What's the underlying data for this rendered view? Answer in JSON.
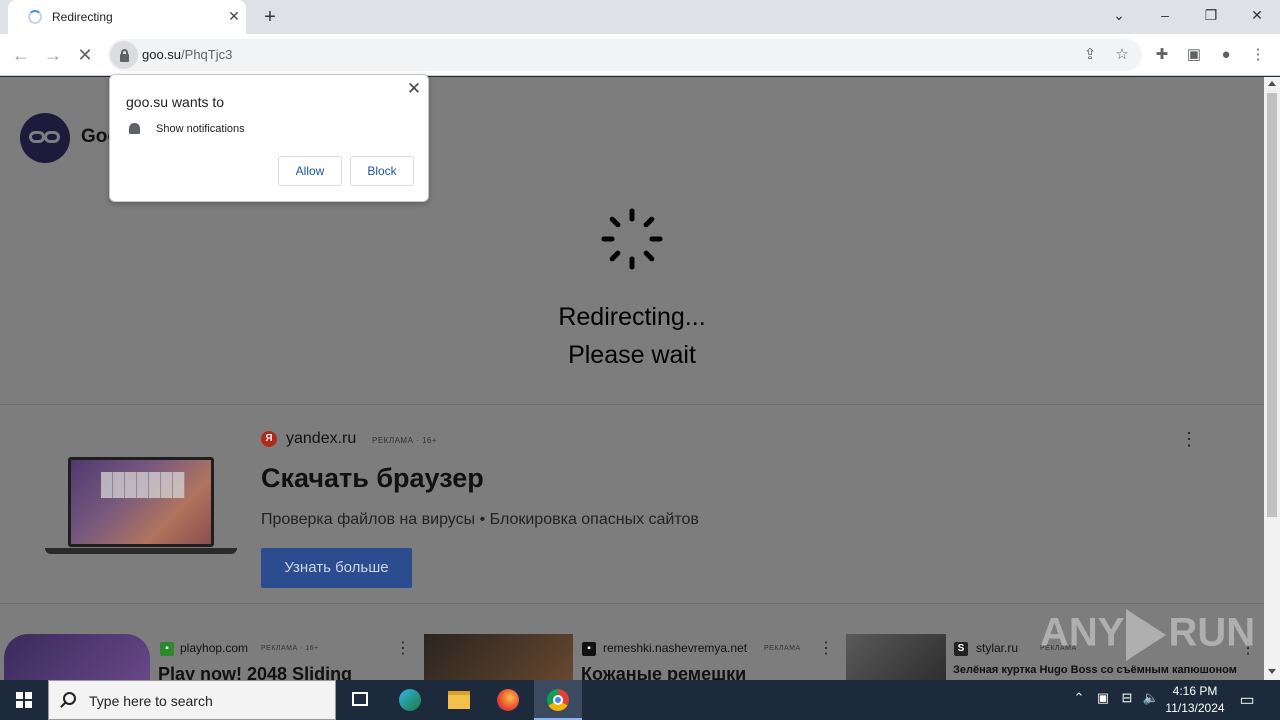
{
  "browser": {
    "tab": {
      "title": "Redirecting"
    },
    "address": {
      "domain": "goo.su",
      "path": "/PhqTjc3"
    }
  },
  "page": {
    "logo_text": "Goo",
    "redirect_line1": "Redirecting...",
    "redirect_line2": "Please wait"
  },
  "permission_popup": {
    "title": "goo.su wants to",
    "permission": "Show notifications",
    "allow_label": "Allow",
    "block_label": "Block"
  },
  "ad_main": {
    "icon_letter": "Я",
    "domain": "yandex.ru",
    "tag": "РЕКЛАМА · 16+",
    "title": "Скачать браузер",
    "description": "Проверка файлов на вирусы • Блокировка опасных сайтов",
    "button_label": "Узнать больше"
  },
  "ad_cards": [
    {
      "domain": "playhop.com",
      "tag": "РЕКЛАМА · 16+",
      "title": "Play now! 2048 Sliding"
    },
    {
      "domain": "remeshki.nashevremya.net",
      "tag": "РЕКЛАМА",
      "title": "Кожаные ремешки"
    },
    {
      "domain": "stylar.ru",
      "tag": "РЕКЛАМА",
      "title": "Зелёная куртка Hugo Boss со съёмным капюшоном"
    }
  ],
  "watermark": {
    "left": "ANY",
    "right": "RUN"
  },
  "taskbar": {
    "search_placeholder": "Type here to search",
    "time": "4:16 PM",
    "date": "11/13/2024"
  },
  "colors": {
    "overlay": "#7d7d7d",
    "ad_button": "#2b4c8e",
    "popup_button_text": "#1a56a8",
    "taskbar": "#1d2a3c"
  },
  "icons": [
    "loading-spinner-icon",
    "close-icon",
    "new-tab-icon",
    "back-arrow-icon",
    "forward-arrow-icon",
    "stop-icon",
    "lock-icon",
    "share-icon",
    "star-icon",
    "extensions-icon",
    "side-panel-icon",
    "profile-icon",
    "menu-icon",
    "bell-icon",
    "windows-logo-icon",
    "search-icon",
    "task-view-icon",
    "edge-icon",
    "file-explorer-icon",
    "firefox-icon",
    "chrome-icon",
    "notification-icon"
  ]
}
